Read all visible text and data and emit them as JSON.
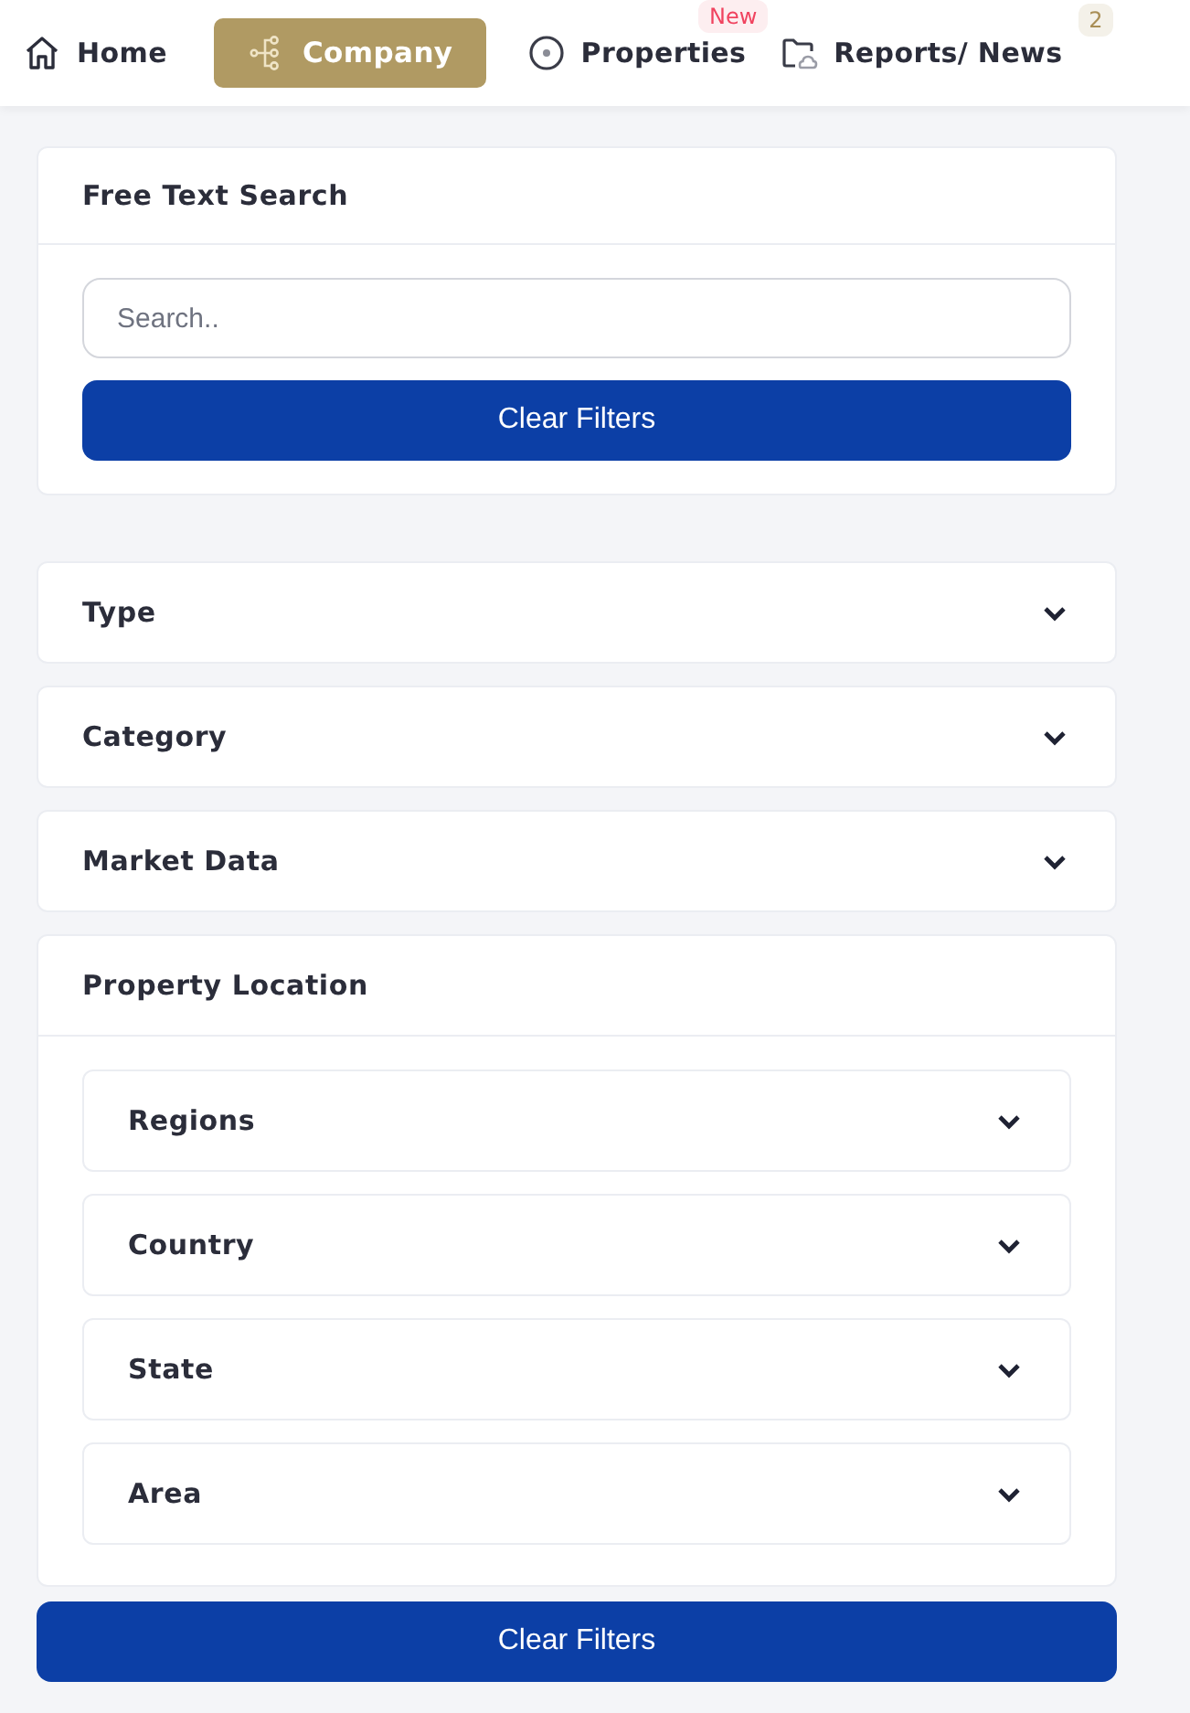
{
  "nav": [
    {
      "label": "Home",
      "kind": "home",
      "selected": false
    },
    {
      "label": "Company",
      "kind": "tree",
      "selected": true
    },
    {
      "label": "Properties",
      "kind": "disc",
      "selected": false,
      "badge": {
        "text": "New",
        "kind": "new"
      }
    },
    {
      "label": "Reports/ News",
      "kind": "folder",
      "selected": false,
      "badge": {
        "text": "2",
        "kind": "count"
      }
    }
  ],
  "search_card": {
    "title": "Free Text Search",
    "placeholder": "Search..",
    "button": "Clear Filters"
  },
  "filters": [
    {
      "title": "Type",
      "expanded": false
    },
    {
      "title": "Category",
      "expanded": false
    },
    {
      "title": "Market Data",
      "expanded": false
    },
    {
      "title": "Property Location",
      "expanded": true,
      "children": [
        {
          "title": "Regions",
          "expanded": false
        },
        {
          "title": "Country",
          "expanded": false
        },
        {
          "title": "State",
          "expanded": false
        },
        {
          "title": "Area",
          "expanded": false
        }
      ]
    }
  ],
  "bottom_button": "Clear Filters"
}
